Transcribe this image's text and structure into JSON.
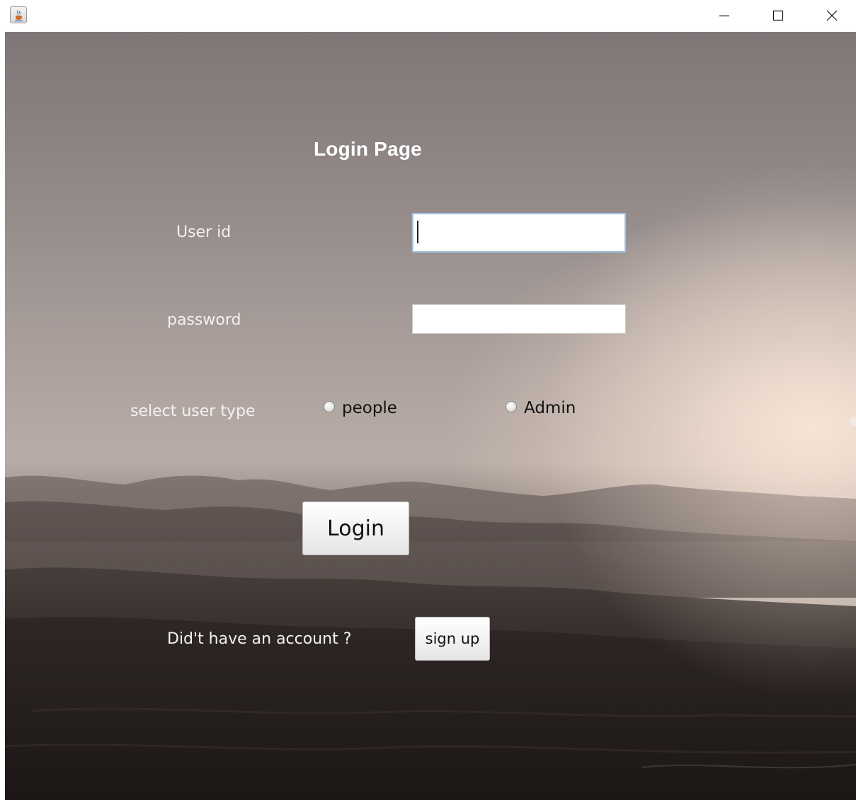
{
  "window": {
    "icon": "java-cup-icon",
    "controls": {
      "minimize_icon": "minimize-icon",
      "maximize_icon": "maximize-icon",
      "close_icon": "close-icon"
    }
  },
  "login": {
    "title": "Login Page",
    "user_id_label": "User id",
    "user_id_value": "",
    "password_label": "password",
    "password_value": "",
    "user_type_label": "select user type",
    "user_type_options": [
      "people",
      "Admin"
    ],
    "login_button": "Login",
    "account_prompt": "Did't have an account ?",
    "signup_button": "sign up"
  }
}
